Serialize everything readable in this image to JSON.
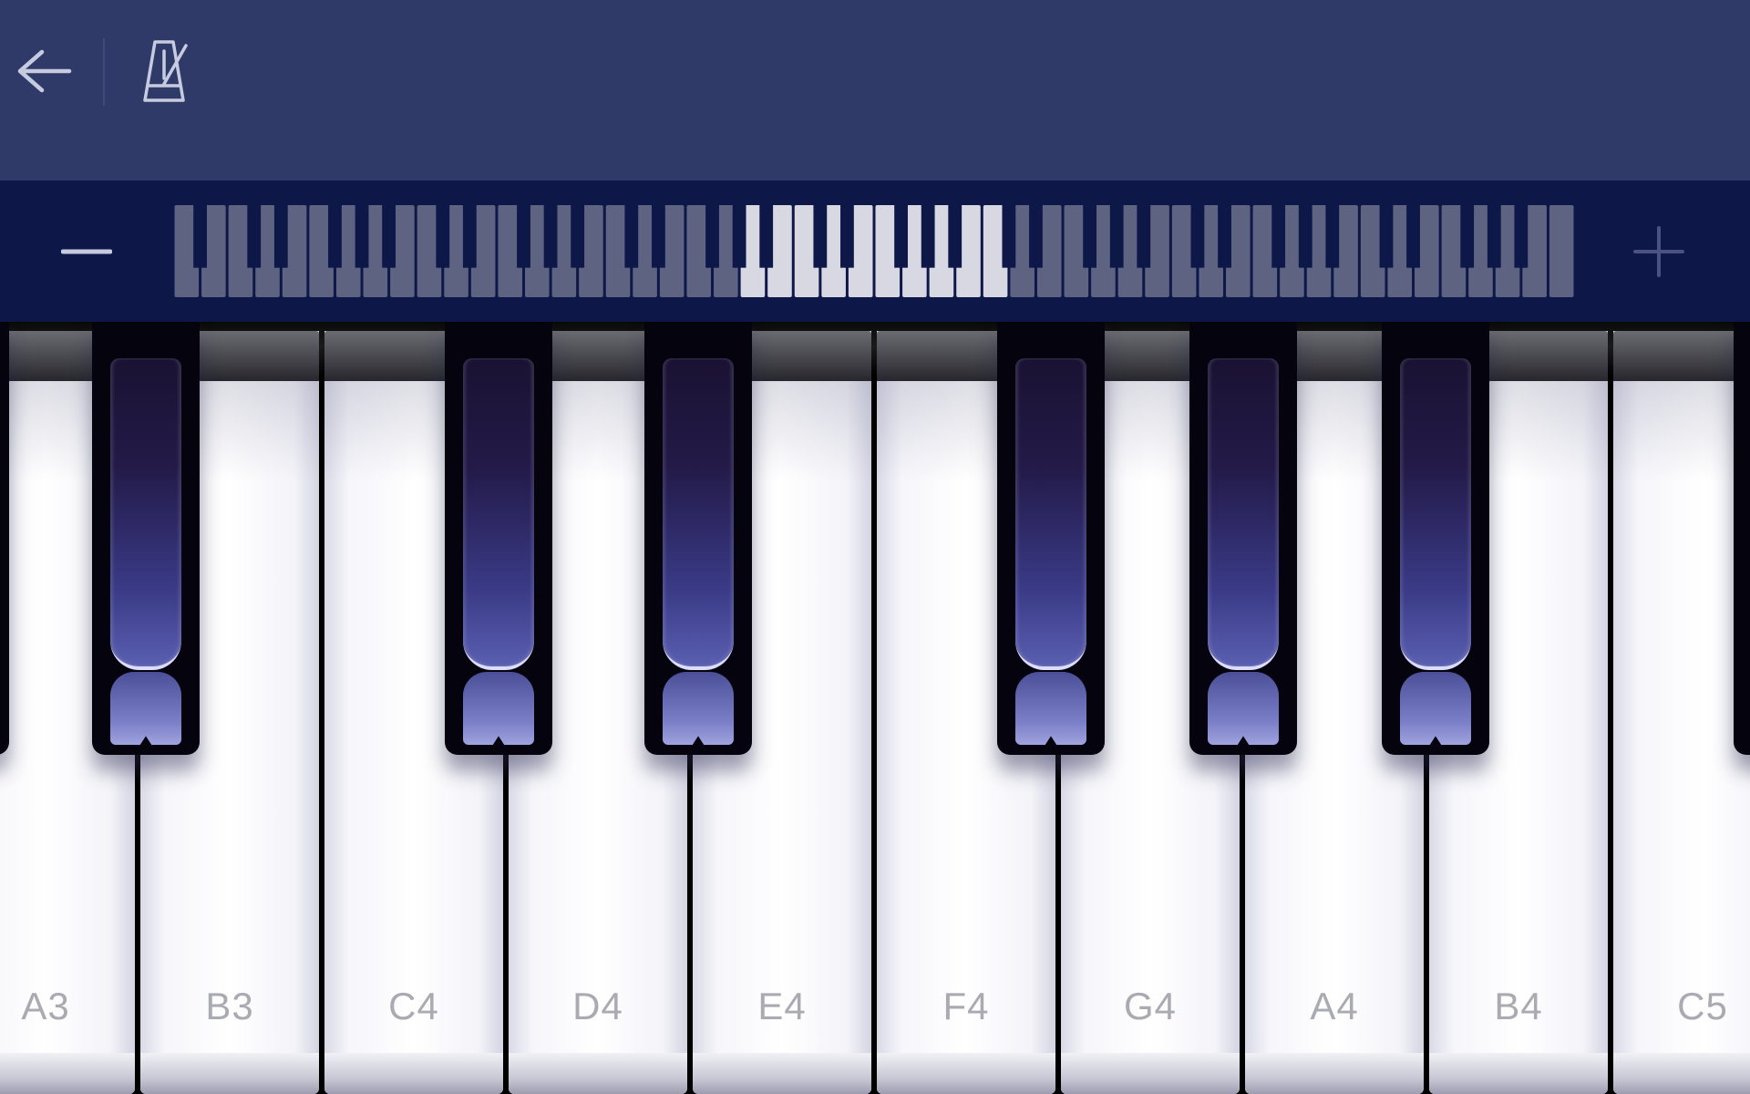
{
  "toolbar": {
    "back_icon": "arrow-left-icon",
    "metronome_icon": "metronome-icon"
  },
  "navigator": {
    "zoom_out_icon": "minus-icon",
    "zoom_in_icon": "plus-icon",
    "total_white_keys": 52,
    "visible_range": [
      "A3",
      "C5"
    ]
  },
  "keyboard": {
    "white_keys": [
      {
        "label": "A3"
      },
      {
        "label": "B3"
      },
      {
        "label": "C4"
      },
      {
        "label": "D4"
      },
      {
        "label": "E4"
      },
      {
        "label": "F4"
      },
      {
        "label": "G4"
      },
      {
        "label": "A4"
      },
      {
        "label": "B4"
      },
      {
        "label": "C5"
      }
    ],
    "black_keys": [
      "G#3",
      "A#3",
      "C#4",
      "D#4",
      "F#4",
      "G#4",
      "A#4",
      "C#5"
    ]
  },
  "colors": {
    "toolbar_bg": "#303a69",
    "navigator_bg": "#0d1748",
    "icon_color": "#c7cbe0",
    "key_label_color": "#aaaab3"
  }
}
